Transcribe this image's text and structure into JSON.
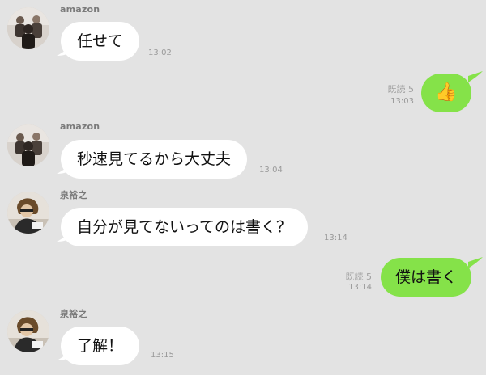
{
  "conversation": {
    "messages": [
      {
        "sender": "amazon",
        "text": "任せて",
        "time": "13:02"
      },
      {
        "own": true,
        "read": "既読 5",
        "time": "13:03",
        "sticker": "thumbs-up",
        "text": "👍"
      },
      {
        "sender": "amazon",
        "text": "秒速見てるから大丈夫",
        "time": "13:04"
      },
      {
        "sender": "泉裕之",
        "text": "自分が見てないってのは書く？",
        "time": "13:14"
      },
      {
        "own": true,
        "read": "既読 5",
        "time": "13:14",
        "text": "僕は書く"
      },
      {
        "sender": "泉裕之",
        "text": "了解！",
        "time": "13:15"
      }
    ]
  },
  "colors": {
    "background": "#e3e3e3",
    "incoming_bubble": "#ffffff",
    "outgoing_bubble": "#85e249"
  }
}
